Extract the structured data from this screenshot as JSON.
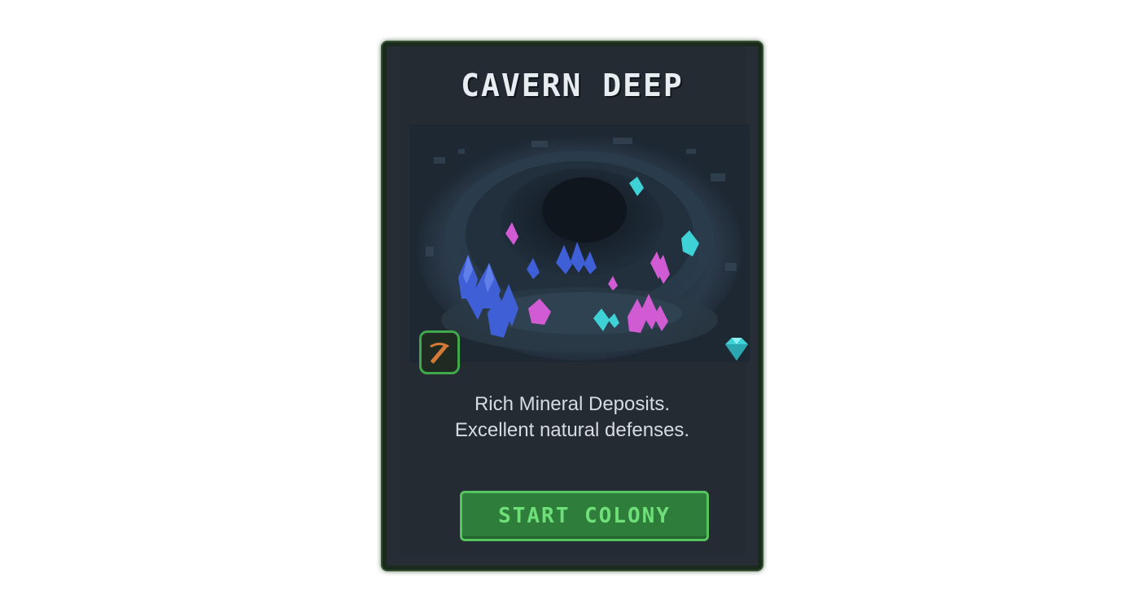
{
  "card": {
    "title": "CAVERN DEEP",
    "description_lines": [
      "Rich Mineral Deposits.",
      "Excellent natural defenses."
    ],
    "button_label": "START COLONY"
  },
  "icons": {
    "resource": "pickaxe-icon",
    "bonus": "diamond-icon"
  },
  "colors": {
    "accent": "#56c45e",
    "button_fill": "#2e7d3a",
    "card_bg": "#252b33",
    "gem_blue": "#3f5fd6",
    "gem_pink": "#d05bd3",
    "gem_cyan": "#3ed1d6"
  }
}
